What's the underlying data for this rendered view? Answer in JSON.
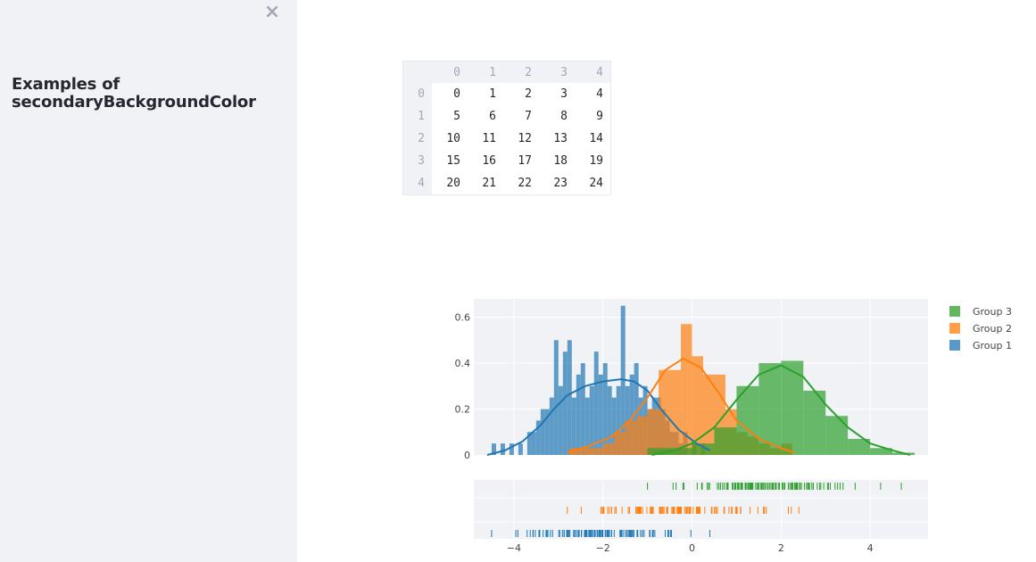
{
  "sidebar": {
    "title": "Examples of secondaryBackgroundColor",
    "close_icon": "×"
  },
  "dataframe": {
    "columns": [
      "0",
      "1",
      "2",
      "3",
      "4"
    ],
    "index": [
      "0",
      "1",
      "2",
      "3",
      "4"
    ],
    "rows": [
      [
        "0",
        "1",
        "2",
        "3",
        "4"
      ],
      [
        "5",
        "6",
        "7",
        "8",
        "9"
      ],
      [
        "10",
        "11",
        "12",
        "13",
        "14"
      ],
      [
        "15",
        "16",
        "17",
        "18",
        "19"
      ],
      [
        "20",
        "21",
        "22",
        "23",
        "24"
      ]
    ]
  },
  "colors": {
    "sidebar_bg": "#f0f2f6",
    "plot_bg": "#f0f2f6",
    "group1": "#1f77b4",
    "group2": "#ff7f0e",
    "group3": "#2ca02c"
  },
  "chart_data": {
    "type": "histogram-distplot",
    "x_ticks": [
      -4,
      -2,
      0,
      2,
      4
    ],
    "x_tick_labels": [
      "−4",
      "−2",
      "0",
      "2",
      "4"
    ],
    "y_ticks": [
      0,
      0.2,
      0.4,
      0.6
    ],
    "y_tick_labels": [
      "0",
      "0.2",
      "0.4",
      "0.6"
    ],
    "xlim": [
      -4.9,
      5.3
    ],
    "ylim": [
      0,
      0.68
    ],
    "legend_position": "top-right",
    "legend": [
      "Group 3",
      "Group 2",
      "Group 1"
    ],
    "series": [
      {
        "name": "Group 1",
        "color": "#1f77b4",
        "bin_width": 0.1,
        "bins": [
          [
            -4.5,
            0.05
          ],
          [
            -4.3,
            0.05
          ],
          [
            -4.1,
            0.05
          ],
          [
            -3.9,
            0.05
          ],
          [
            -3.7,
            0.1
          ],
          [
            -3.6,
            0.1
          ],
          [
            -3.5,
            0.15
          ],
          [
            -3.4,
            0.2
          ],
          [
            -3.3,
            0.2
          ],
          [
            -3.2,
            0.25
          ],
          [
            -3.1,
            0.5
          ],
          [
            -3.0,
            0.3
          ],
          [
            -2.9,
            0.45
          ],
          [
            -2.8,
            0.5
          ],
          [
            -2.7,
            0.25
          ],
          [
            -2.6,
            0.35
          ],
          [
            -2.5,
            0.4
          ],
          [
            -2.4,
            0.25
          ],
          [
            -2.3,
            0.3
          ],
          [
            -2.2,
            0.45
          ],
          [
            -2.1,
            0.35
          ],
          [
            -2.0,
            0.4
          ],
          [
            -1.9,
            0.3
          ],
          [
            -1.8,
            0.25
          ],
          [
            -1.7,
            0.3
          ],
          [
            -1.6,
            0.65
          ],
          [
            -1.5,
            0.3
          ],
          [
            -1.4,
            0.35
          ],
          [
            -1.3,
            0.4
          ],
          [
            -1.2,
            0.25
          ],
          [
            -1.1,
            0.3
          ],
          [
            -1.0,
            0.2
          ],
          [
            -0.9,
            0.25
          ],
          [
            -0.8,
            0.25
          ],
          [
            -0.7,
            0.2
          ],
          [
            -0.6,
            0.15
          ],
          [
            -0.5,
            0.1
          ],
          [
            -0.4,
            0.1
          ],
          [
            -0.3,
            0.05
          ],
          [
            -0.2,
            0.1
          ],
          [
            0.0,
            0.05
          ],
          [
            0.2,
            0.05
          ]
        ],
        "kde": [
          [
            -4.6,
            0.0
          ],
          [
            -4.2,
            0.02
          ],
          [
            -3.8,
            0.06
          ],
          [
            -3.4,
            0.13
          ],
          [
            -3.1,
            0.2
          ],
          [
            -2.8,
            0.26
          ],
          [
            -2.4,
            0.3
          ],
          [
            -2.0,
            0.32
          ],
          [
            -1.6,
            0.33
          ],
          [
            -1.3,
            0.32
          ],
          [
            -1.0,
            0.28
          ],
          [
            -0.7,
            0.2
          ],
          [
            -0.3,
            0.11
          ],
          [
            0.1,
            0.05
          ],
          [
            0.4,
            0.02
          ]
        ],
        "rug_x_range": [
          -4.5,
          0.4
        ]
      },
      {
        "name": "Group 2",
        "color": "#ff7f0e",
        "bin_width": 0.25,
        "bins": [
          [
            -2.75,
            0.03
          ],
          [
            -2.5,
            0.03
          ],
          [
            -2.25,
            0.03
          ],
          [
            -2.0,
            0.05
          ],
          [
            -1.75,
            0.1
          ],
          [
            -1.5,
            0.15
          ],
          [
            -1.25,
            0.17
          ],
          [
            -1.0,
            0.2
          ],
          [
            -0.75,
            0.37
          ],
          [
            -0.5,
            0.37
          ],
          [
            -0.25,
            0.57
          ],
          [
            0.0,
            0.43
          ],
          [
            0.25,
            0.35
          ],
          [
            0.5,
            0.35
          ],
          [
            0.75,
            0.2
          ],
          [
            1.0,
            0.1
          ],
          [
            1.25,
            0.08
          ],
          [
            1.5,
            0.05
          ],
          [
            1.75,
            0.03
          ],
          [
            2.0,
            0.05
          ]
        ],
        "kde": [
          [
            -2.8,
            0.01
          ],
          [
            -2.3,
            0.04
          ],
          [
            -1.8,
            0.08
          ],
          [
            -1.4,
            0.15
          ],
          [
            -1.0,
            0.25
          ],
          [
            -0.6,
            0.37
          ],
          [
            -0.2,
            0.42
          ],
          [
            0.2,
            0.38
          ],
          [
            0.6,
            0.27
          ],
          [
            1.0,
            0.15
          ],
          [
            1.5,
            0.07
          ],
          [
            2.0,
            0.03
          ],
          [
            2.3,
            0.01
          ]
        ],
        "rug_x_range": [
          -2.8,
          2.4
        ]
      },
      {
        "name": "Group 3",
        "color": "#2ca02c",
        "bin_width": 0.5,
        "bins": [
          [
            -1.0,
            0.03
          ],
          [
            -0.5,
            0.03
          ],
          [
            0.0,
            0.05
          ],
          [
            0.5,
            0.12
          ],
          [
            1.0,
            0.3
          ],
          [
            1.5,
            0.4
          ],
          [
            2.0,
            0.41
          ],
          [
            2.5,
            0.28
          ],
          [
            3.0,
            0.17
          ],
          [
            3.5,
            0.07
          ],
          [
            4.0,
            0.03
          ],
          [
            4.5,
            0.01
          ]
        ],
        "kde": [
          [
            -0.9,
            0.0
          ],
          [
            -0.4,
            0.02
          ],
          [
            0.0,
            0.05
          ],
          [
            0.5,
            0.12
          ],
          [
            1.0,
            0.24
          ],
          [
            1.5,
            0.35
          ],
          [
            2.0,
            0.39
          ],
          [
            2.5,
            0.34
          ],
          [
            3.0,
            0.22
          ],
          [
            3.5,
            0.12
          ],
          [
            4.0,
            0.05
          ],
          [
            4.5,
            0.02
          ],
          [
            4.9,
            0.0
          ]
        ],
        "rug_x_range": [
          -1.0,
          4.7
        ]
      }
    ]
  }
}
